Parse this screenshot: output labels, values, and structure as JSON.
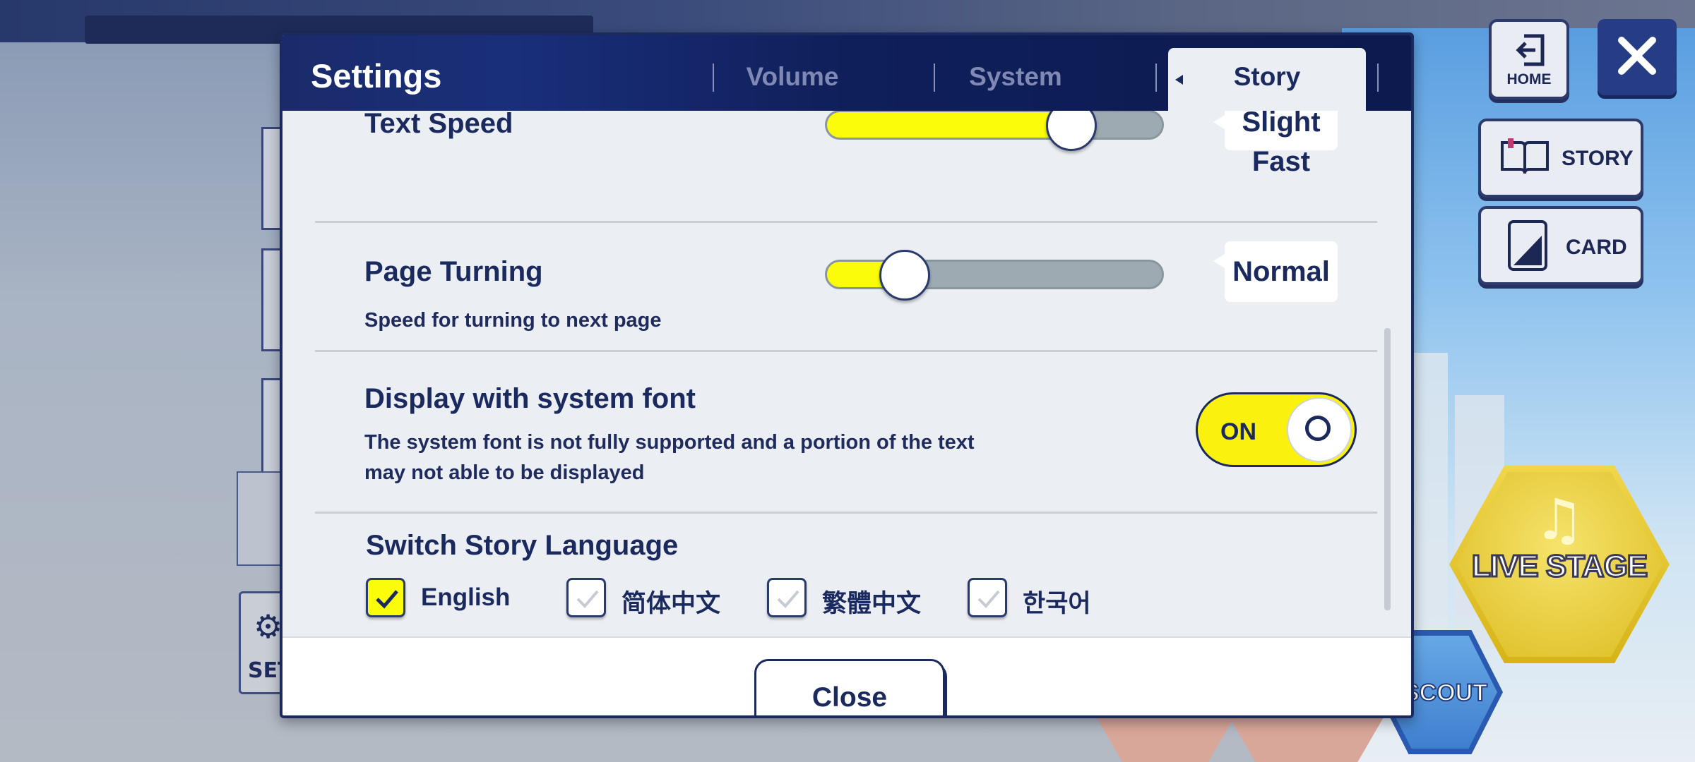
{
  "dialog": {
    "title": "Settings",
    "tabs": [
      {
        "label": "Volume",
        "active": false
      },
      {
        "label": "System",
        "active": false
      },
      {
        "label": "Story",
        "active": true
      }
    ],
    "close_label": "Close"
  },
  "settings": {
    "text_speed": {
      "label": "Text Speed",
      "value_label": "Slight\nFast",
      "level": 0.72
    },
    "page_turning": {
      "label": "Page Turning",
      "description": "Speed for turning to next page",
      "value_label": "Normal",
      "level": 0.23
    },
    "system_font": {
      "label": "Display with system font",
      "description": "The system font is not fully supported and a portion of the text\nmay not able to be displayed",
      "toggle_label": "ON",
      "enabled": true
    },
    "story_language": {
      "label": "Switch Story Language",
      "options": [
        {
          "name": "English",
          "checked": true
        },
        {
          "name": "简体中文",
          "checked": false
        },
        {
          "name": "繁體中文",
          "checked": false
        },
        {
          "name": "한국어",
          "checked": false
        }
      ]
    }
  },
  "side_menu": {
    "home_label": "HOME",
    "story_label": "STORY",
    "card_label": "CARD",
    "live_stage_label": "LIVE STAGE",
    "scout_label": "SCOUT"
  },
  "colors": {
    "accent_yellow": "#fbfc0a",
    "navy": "#1b2a5e",
    "panel": "#ebeef2"
  }
}
